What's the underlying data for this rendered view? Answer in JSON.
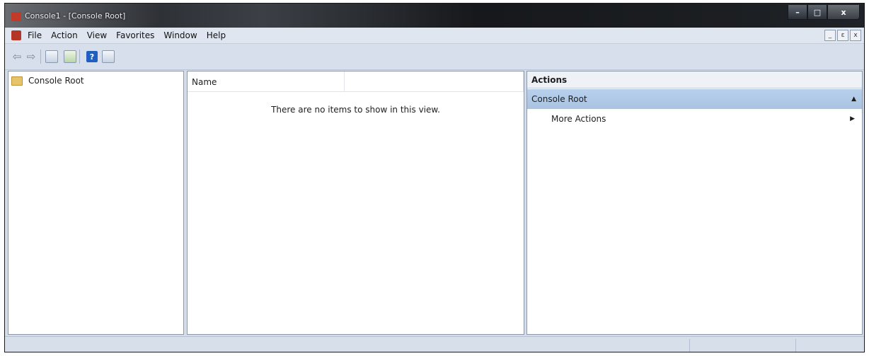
{
  "window": {
    "title": "Console1 - [Console Root]",
    "caption_buttons": {
      "minimize": "–",
      "maximize": "□",
      "close": "x"
    }
  },
  "menu": {
    "items": [
      "File",
      "Action",
      "View",
      "Favorites",
      "Window",
      "Help"
    ],
    "mdi_buttons": {
      "minimize": "_",
      "restore": "ε",
      "close": "x"
    }
  },
  "toolbar": {
    "buttons": [
      "back-arrow",
      "forward-arrow",
      "show-hide-console-tree",
      "export-list",
      "help",
      "show-hide-action-pane"
    ],
    "help_glyph": "?"
  },
  "tree": {
    "root_label": "Console Root"
  },
  "list": {
    "columns": [
      "Name",
      ""
    ],
    "empty_message": "There are no items to show in this view."
  },
  "actions": {
    "header": "Actions",
    "section_title": "Console Root",
    "items": [
      {
        "label": "More Actions"
      }
    ]
  },
  "colors": {
    "selection_blue": "#b8d0ec",
    "window_chrome": "#d4dde9",
    "title_dark": "#1f2226"
  }
}
